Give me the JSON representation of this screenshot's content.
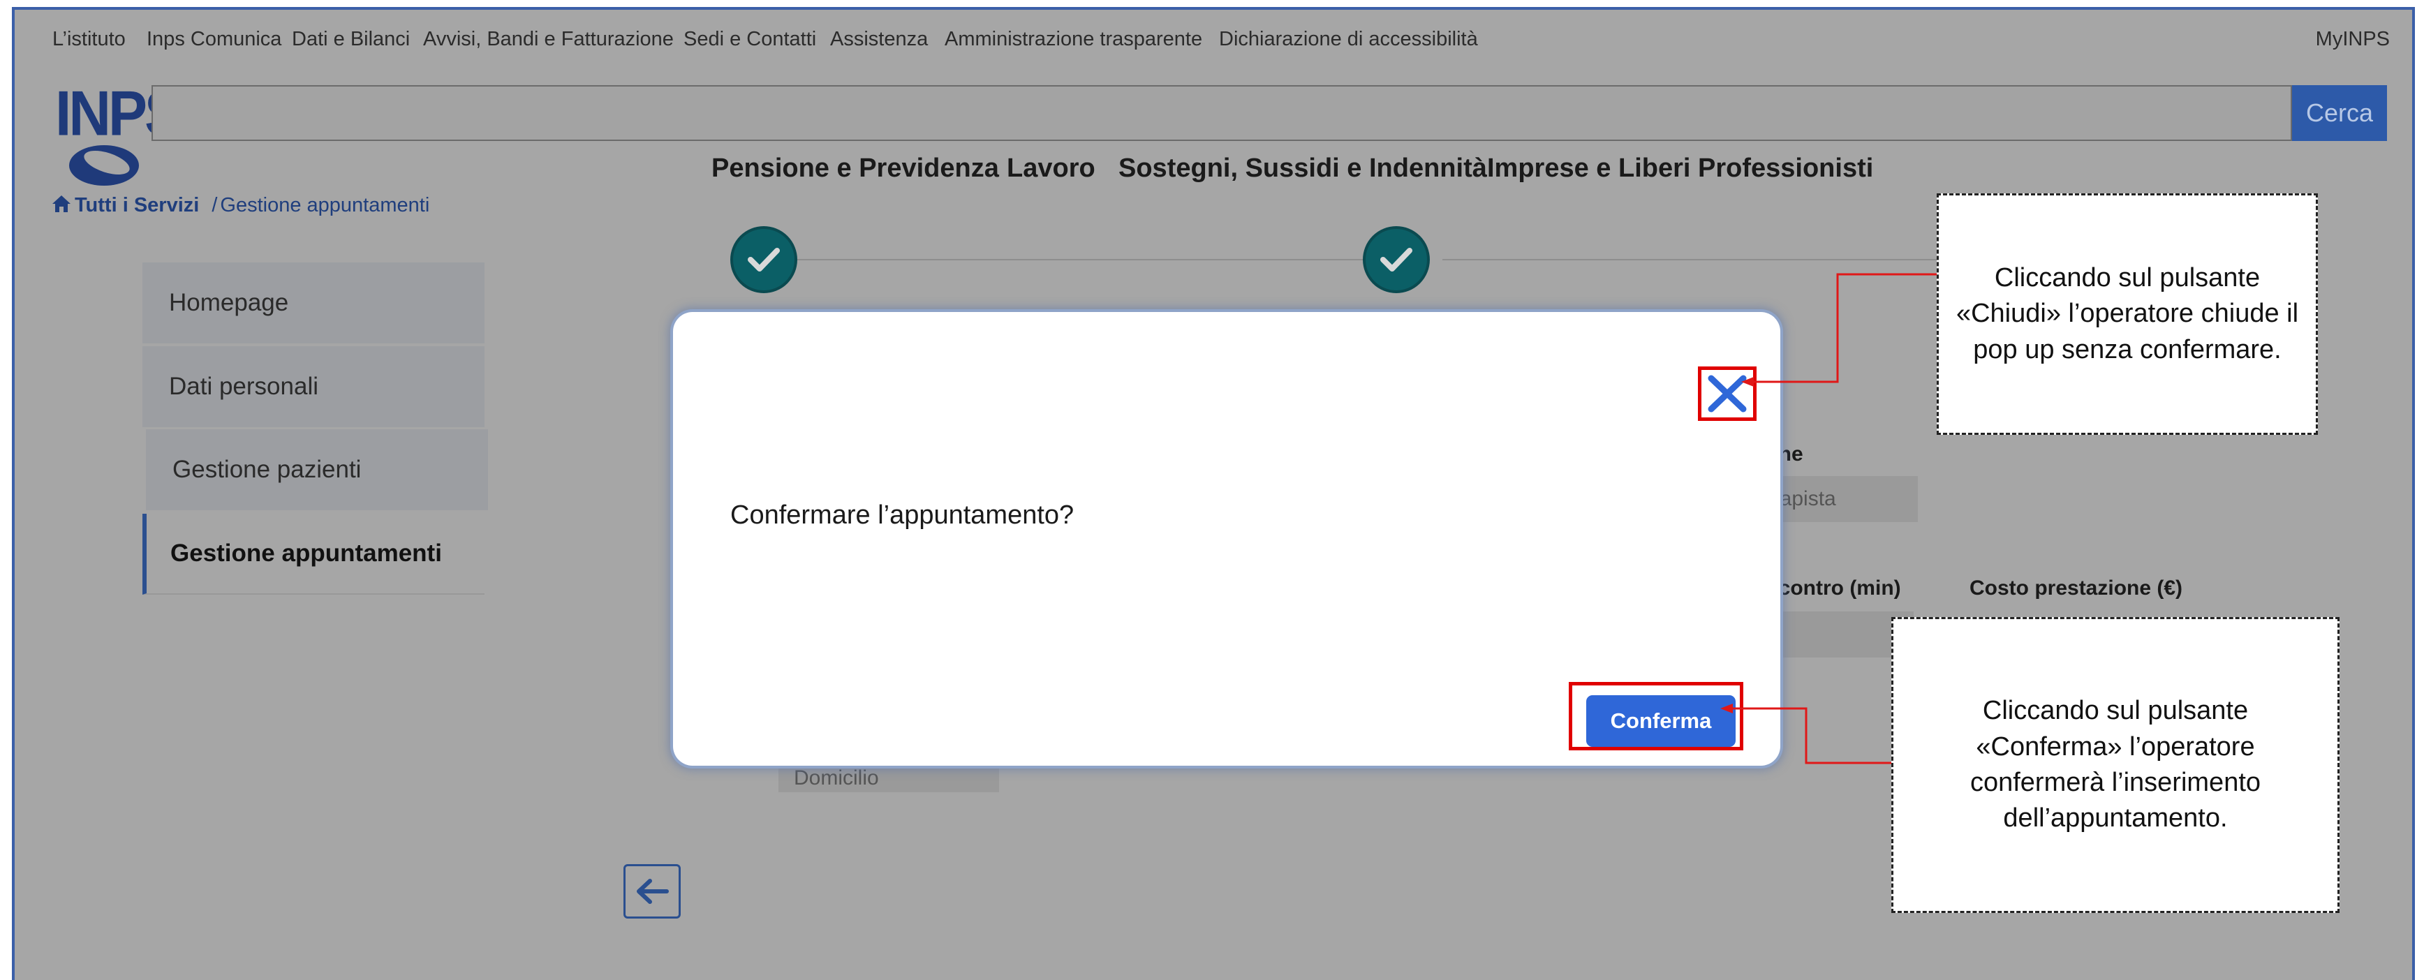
{
  "topnav": {
    "items": [
      "L’istituto",
      "Inps Comunica",
      "Dati e Bilanci",
      "Avvisi, Bandi e Fatturazione",
      "Sedi e Contatti",
      "Assistenza",
      "Amministrazione trasparente",
      "Dichiarazione di accessibilità"
    ],
    "myinps": "MyINPS"
  },
  "header": {
    "logo_text": "INPS",
    "search_placeholder": "",
    "search_button": "Cerca"
  },
  "mainnav": {
    "items": [
      "Pensione e Previdenza",
      "Lavoro",
      "Sostegni, Sussidi e Indennità",
      "Imprese e Liberi Professionisti"
    ]
  },
  "breadcrumb": {
    "home": "Tutti i Servizi",
    "separator": "/",
    "current": "Gestione appuntamenti"
  },
  "sidebar": {
    "items": [
      {
        "label": "Homepage"
      },
      {
        "label": "Dati personali"
      },
      {
        "label": "Gestione pazienti"
      },
      {
        "label": "Gestione appuntamenti"
      }
    ]
  },
  "background": {
    "label_prestazione": "ione",
    "value_prestazione": "erapista",
    "label_durata": "incontro (min)",
    "label_costo": "Costo prestazione (€)",
    "value_luogo": "Domicilio"
  },
  "modal": {
    "message": "Confermare l’appuntamento?",
    "confirm_label": "Conferma"
  },
  "callouts": {
    "close_text": "Cliccando sul pulsante «Chiudi» l’operatore chiude il pop up senza confermare.",
    "confirm_text": "Cliccando sul pulsante «Conferma» l’operatore confermerà l’inserimento dell’appuntamento."
  },
  "colors": {
    "accent": "#2f67d8",
    "brand": "#1f3a7a",
    "highlight": "#e00000",
    "step": "#0b5f66",
    "overlay": "#a6a6a6"
  },
  "icons": {
    "close": "close-icon",
    "check": "check-icon",
    "home": "home-icon",
    "back": "arrow-left-icon"
  }
}
